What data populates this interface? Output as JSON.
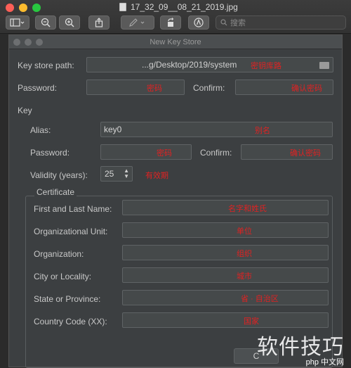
{
  "window": {
    "title": "17_32_09__08_21_2019.jpg"
  },
  "toolbar": {
    "search_placeholder": "搜索"
  },
  "dialog": {
    "title": "New Key Store",
    "key_store_path": {
      "label": "Key store path:",
      "value": "...g/Desktop/2019/system",
      "annotation": "密钥库路"
    },
    "password": {
      "label": "Password:",
      "annotation": "密码"
    },
    "confirm": {
      "label": "Confirm:",
      "annotation": "确认密码"
    },
    "key_section": "Key",
    "alias": {
      "label": "Alias:",
      "value": "key0",
      "annotation": "别名"
    },
    "key_password": {
      "label": "Password:",
      "annotation": "密码"
    },
    "key_confirm": {
      "label": "Confirm:",
      "annotation": "确认密码"
    },
    "validity": {
      "label": "Validity (years):",
      "value": "25",
      "annotation": "有效期"
    },
    "certificate": {
      "title": "Certificate",
      "rows": [
        {
          "label": "First and Last Name:",
          "annotation": "名字和姓氏"
        },
        {
          "label": "Organizational Unit:",
          "annotation": "单位"
        },
        {
          "label": "Organization:",
          "annotation": "组织"
        },
        {
          "label": "City or Locality:",
          "annotation": "城市"
        },
        {
          "label": "State or Province:",
          "annotation": "省 · 自治区"
        },
        {
          "label": "Country Code (XX):",
          "annotation": "国家"
        }
      ]
    },
    "ok_label": "C"
  },
  "watermark": {
    "text": "软件技巧",
    "sub": "php 中文网"
  }
}
